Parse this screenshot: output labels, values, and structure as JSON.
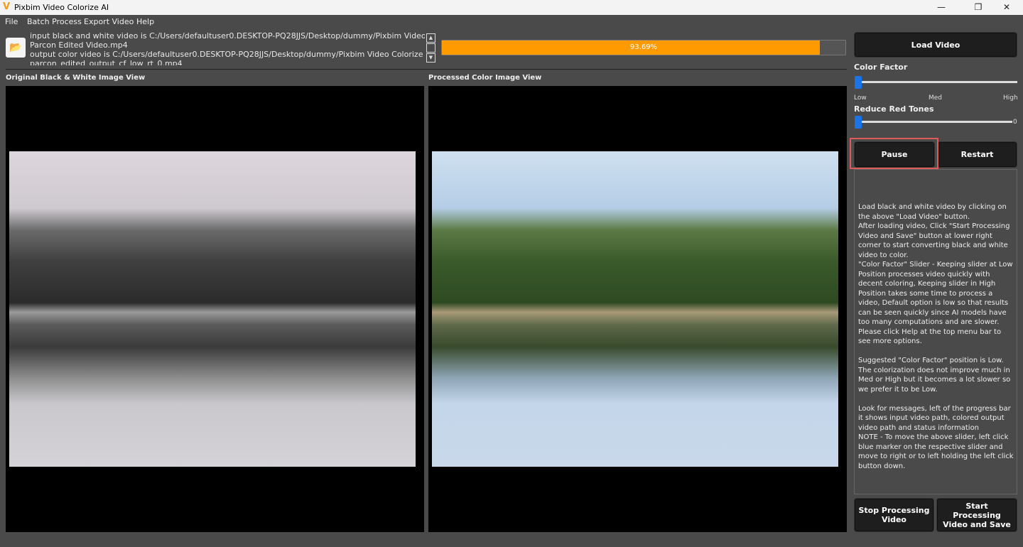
{
  "window": {
    "title": "Pixbim Video Colorize AI",
    "controls": [
      "minimize",
      "maximize",
      "close"
    ]
  },
  "menu": [
    "File",
    "Batch Process",
    "Export Video",
    "Help"
  ],
  "messages": [
    "input black and white video is C:/Users/defaultuser0.DESKTOP-PQ28JJS/Desktop/dummy/Pixbim Video Colorize AI/",
    "Parcon Edited Video.mp4",
    "output color video is C:/Users/defaultuser0.DESKTOP-PQ28JJS/Desktop/dummy/Pixbim Video Colorize AI/Colorized/",
    "parcon_edited_output_cf_low_rt_0.mp4"
  ],
  "progress": {
    "label": "93.69%",
    "value": 93.69,
    "color": "#ff9a00"
  },
  "views": {
    "original_label": "Original Black & White Image View",
    "processed_label": "Processed Color Image View"
  },
  "panel": {
    "load_video": "Load Video",
    "color_factor": {
      "label": "Color Factor",
      "ticks": [
        "Low",
        "Med",
        "High"
      ],
      "value": "Low"
    },
    "reduce_red": {
      "label": "Reduce Red Tones",
      "value": "0"
    },
    "pause": "Pause",
    "restart": "Restart",
    "help": [
      "Load black and white video by clicking on the above \"Load Video\" button.\nAfter loading video, Click \"Start Processing Video and Save\" button at lower right corner to start converting black and white video to color.\n\"Color Factor\" Slider - Keeping slider at Low Position processes video quickly with decent coloring, Keeping slider in High Position takes some time to process a video, Default option is low so that results can be seen quickly since AI models have too many computations and are slower.\nPlease click Help at the top menu bar to see more options.",
      "Suggested \"Color Factor\" position is Low. The colorization does not improve much in Med or High but it becomes a lot slower so we prefer it to be Low.",
      "Look for messages, left of the progress bar it shows input video path, colored output video path and status information\nNOTE - To move the above slider, left click blue marker on the respective slider and move to right or to left holding the left click button down."
    ],
    "stop": "Stop Processing Video",
    "start": "Start Processing Video and Save",
    "highlight_color": "#e05a5a"
  }
}
